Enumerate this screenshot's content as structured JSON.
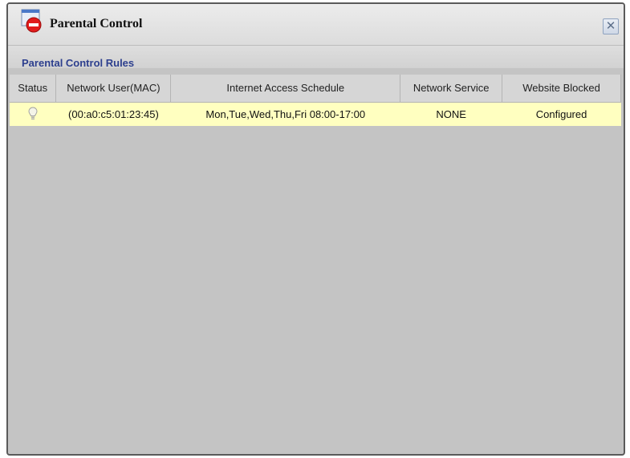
{
  "window": {
    "title": "Parental Control",
    "close_symbol": "✕",
    "icons": {
      "title": "parental-control-icon",
      "close": "close-icon"
    }
  },
  "section": {
    "title": "Parental Control Rules"
  },
  "table": {
    "headers": [
      "Status",
      "Network User(MAC)",
      "Internet Access Schedule",
      "Network Service",
      "Website Blocked"
    ],
    "rows": [
      {
        "status_icon": "bulb-icon",
        "network_user": "(00:a0:c5:01:23:45)",
        "schedule": "Mon,Tue,Wed,Thu,Fri 08:00-17:00",
        "network_service": "NONE",
        "website_blocked": "Configured"
      }
    ]
  },
  "colors": {
    "section_title": "#2d3f8e",
    "row_highlight": "#ffffc0",
    "window_bg": "#c4c4c4"
  }
}
